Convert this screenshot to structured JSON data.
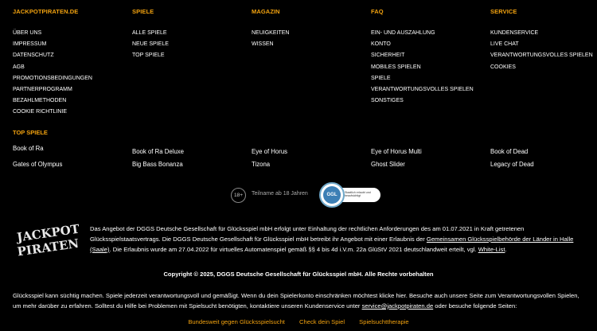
{
  "columns": [
    {
      "title": "JACKPOTPIRATEN.DE",
      "items": [
        "ÜBER UNS",
        "IMPRESSUM",
        "DATENSCHUTZ",
        "AGB",
        "PROMOTIONSBEDINGUNGEN",
        "PARTNERPROGRAMM",
        "BEZAHLMETHODEN",
        "COOKIE RICHTLINIE"
      ]
    },
    {
      "title": "SPIELE",
      "items": [
        "ALLE SPIELE",
        "NEUE SPIELE",
        "TOP SPIELE"
      ]
    },
    {
      "title": "MAGAZIN",
      "items": [
        "NEUIGKEITEN",
        "WISSEN"
      ]
    },
    {
      "title": "FAQ",
      "items": [
        "EIN- UND AUSZAHLUNG",
        "KONTO",
        "SICHERHEIT",
        "MOBILES SPIELEN",
        "SPIELE",
        "VERANTWORTUNGSVOLLES SPIELEN",
        "SONSTIGES"
      ]
    },
    {
      "title": "SERVICE",
      "items": [
        "KUNDENSERVICE",
        "LIVE CHAT",
        "VERANTWORTUNGSVOLLES SPIELEN",
        "COOKIES"
      ]
    }
  ],
  "top_games": {
    "title": "TOP SPIELE",
    "row1": [
      "Book of Ra",
      "Book of Ra Deluxe",
      "Eye of Horus",
      "Eye of Horus Multi",
      "Book of Dead"
    ],
    "row2": [
      "Gates of Olympus",
      "Big Bass Bonanza",
      "Tizona",
      "Ghost Slider",
      "Legacy of Dead"
    ]
  },
  "badges": {
    "age": "18+",
    "age_text": "Teilname ab 18 Jahren",
    "ggl_abbr": "GGL",
    "ggl_text": "Staatlich erlaubt und beaufsichtigt"
  },
  "logo": {
    "line1": "JACKPOT",
    "line2": "PIRATEN"
  },
  "notice": {
    "part1": "Das Angebot der DGGS Deutsche Gesellschaft für Glücksspiel mbH erfolgt unter Einhaltung der rechtlichen Anforderungen des am 01.07.2021 in Kraft getretenen Glücksspielstaatsvertrags. Die DGGS Deutsche Gesellschaft für Glücksspiel mbH betreibt ihr Angebot mit einer Erlaubnis der ",
    "link1": "Gemeinsamen Glücksspielbehörde der Länder in Halle (Saale)",
    "part2": ". Die Erlaubnis wurde am 27.04.2022 für virtuelles Automatenspiel gemäß §§ 4 bis 4d i.V.m. 22a GlüStV 2021 deutschlandweit erteilt, vgl. ",
    "link2": "White-List",
    "part3": "."
  },
  "copyright": "Copyright © 2025, DGGS Deutsche Gesellschaft für Glücksspiel mbH. Alle Rechte vorbehalten",
  "warning": {
    "part1": "Glücksspiel kann süchtig machen. Spiele jederzeit verantwortungsvoll und gemäßigt. Wenn du dein Spielerkonto einschränken möchtest klicke hier. Besuche auch unsere Seite zum Verantwortungsvollen Spielen, um mehr darüber zu erfahren. Solltest du Hilfe bei Problemen mit Spielsucht benötigten, kontaktiere unseren Kundenservice unter ",
    "email": "service@jackpotpiraten.de",
    "part2": " oder besuche folgende Seiten:"
  },
  "bottom_links": [
    "Bundesweit gegen Glücksspielsucht",
    "Check dein Spiel",
    "Spielsuchttherapie"
  ],
  "colors": {
    "accent": "#f2a20f",
    "background": "#000000",
    "text": "#ffffff"
  }
}
